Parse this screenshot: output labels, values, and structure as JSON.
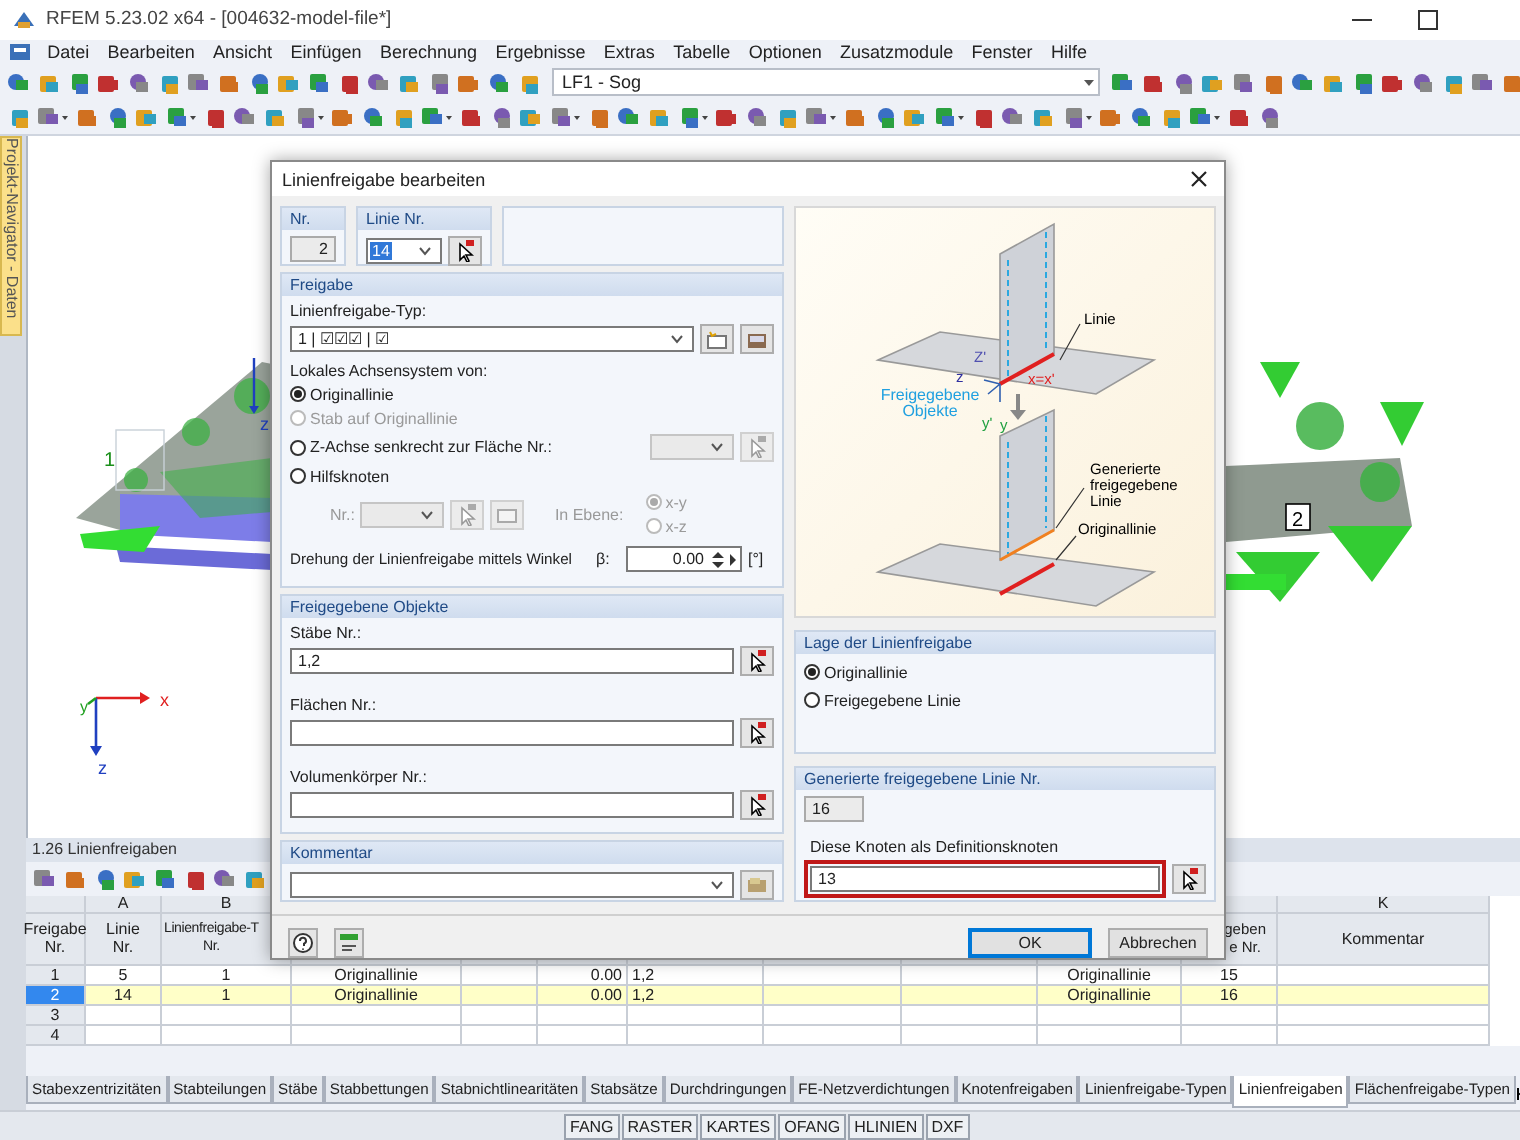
{
  "window": {
    "title": "RFEM 5.23.02 x64 - [004632-model-file*]"
  },
  "menu": [
    "Datei",
    "Bearbeiten",
    "Ansicht",
    "Einfügen",
    "Berechnung",
    "Ergebnisse",
    "Extras",
    "Tabelle",
    "Optionen",
    "Zusatzmodule",
    "Fenster",
    "Hilfe"
  ],
  "toolbar": {
    "load_case": "LF1 - Sog"
  },
  "navigator_tab": "Projekt-Navigator - Daten",
  "view": {
    "labels": [
      {
        "text": "1",
        "color": "#1a8f1a"
      },
      {
        "text": "2",
        "color": "#000000"
      },
      {
        "text": "z",
        "color": "#2040c0"
      },
      {
        "text": "x",
        "color": "#e02020"
      },
      {
        "text": "y",
        "color": "#20a020"
      },
      {
        "text": "z",
        "color": "#2040c0"
      }
    ]
  },
  "table": {
    "title": "1.26 Linienfreigaben",
    "row_header": "Freigabe\nNr.",
    "columns": [
      {
        "letter": "A",
        "header": "Linie\nNr."
      },
      {
        "letter": "B",
        "header": "Linienfreigabe-T\nNr."
      },
      null,
      null,
      null,
      null,
      null,
      null,
      null,
      {
        "header": "geben\ne Nr."
      },
      {
        "letter": "K",
        "header": "Kommentar"
      }
    ],
    "rows": [
      {
        "number": "1",
        "selected": false,
        "cells": [
          "5",
          "1",
          "Originallinie",
          null,
          "0.00",
          "1,2",
          null,
          null,
          "Originallinie",
          "15",
          null
        ]
      },
      {
        "number": "2",
        "selected": true,
        "cells": [
          "14",
          "1",
          "Originallinie",
          null,
          "0.00",
          "1,2",
          null,
          null,
          "Originallinie",
          "16",
          null
        ]
      },
      {
        "number": "3",
        "selected": false,
        "cells": [
          null,
          null,
          null,
          null,
          null,
          null,
          null,
          null,
          null,
          null,
          null
        ]
      },
      {
        "number": "4",
        "selected": false,
        "cells": [
          null,
          null,
          null,
          null,
          null,
          null,
          null,
          null,
          null,
          null,
          null
        ]
      }
    ]
  },
  "sheet_tabs": [
    {
      "label": "Stabexzentrizitäten",
      "selected": false
    },
    {
      "label": "Stabteilungen",
      "selected": false
    },
    {
      "label": "Stäbe",
      "selected": false
    },
    {
      "label": "Stabbettungen",
      "selected": false
    },
    {
      "label": "Stabnichtlinearitäten",
      "selected": false
    },
    {
      "label": "Stabsätze",
      "selected": false
    },
    {
      "label": "Durchdringungen",
      "selected": false
    },
    {
      "label": "FE-Netzverdichtungen",
      "selected": false
    },
    {
      "label": "Knotenfreigaben",
      "selected": false
    },
    {
      "label": "Linienfreigabe-Typen",
      "selected": false
    },
    {
      "label": "Linienfreigaben",
      "selected": true
    },
    {
      "label": "Flächenfreigabe-Typen",
      "selected": false
    }
  ],
  "status_bar": [
    "FANG",
    "RASTER",
    "KARTES",
    "OFANG",
    "HLINIEN",
    "DXF"
  ],
  "dialog": {
    "title": "Linienfreigabe bearbeiten",
    "nr": {
      "label": "Nr.",
      "value": "2"
    },
    "line": {
      "label": "Linie Nr.",
      "value": "14"
    },
    "release": {
      "heading": "Freigabe",
      "type_label": "Linienfreigabe-Typ:",
      "type_value": "1 | ☑☑☑ | ☑",
      "axis_label": "Lokales Achsensystem von:",
      "axis_options": [
        {
          "label": "Originallinie",
          "selected": true,
          "disabled": false
        },
        {
          "label": "Stab auf Originallinie",
          "selected": false,
          "disabled": true
        },
        {
          "label": "Z-Achse senkrecht zur Fläche Nr.:",
          "selected": false,
          "disabled": false
        },
        {
          "label": "Hilfsknoten",
          "selected": false,
          "disabled": false
        }
      ],
      "node_label": "Nr.:",
      "plane_label": "In Ebene:",
      "plane_options": [
        {
          "label": "x-y",
          "selected": true,
          "disabled": true
        },
        {
          "label": "x-z",
          "selected": false,
          "disabled": true
        }
      ],
      "rotation_label": "Drehung der Linienfreigabe mittels Winkel",
      "beta_label": "β:",
      "beta_value": "0.00",
      "unit": "[°]"
    },
    "objects": {
      "heading": "Freigegebene Objekte",
      "fields": [
        {
          "label": "Stäbe Nr.:",
          "value": "1,2"
        },
        {
          "label": "Flächen Nr.:"
        },
        {
          "label": "Volumenkörper Nr.:"
        }
      ]
    },
    "comment": {
      "heading": "Kommentar"
    },
    "figure": {
      "labels": [
        {
          "text": "Linie",
          "color": "#000000"
        },
        {
          "text": "x=x'",
          "color": "#e02020"
        },
        {
          "text": "Z'",
          "color": "#5050b0"
        },
        {
          "text": "z",
          "color": "#3030a0"
        },
        {
          "text": "y'",
          "color": "#20a040"
        },
        {
          "text": "y",
          "color": "#20a040"
        },
        {
          "text": "Freigegebene Objekte",
          "color": "#20a0e0"
        },
        {
          "text": "Generierte freigegebene Linie",
          "color": "#000000"
        },
        {
          "text": "Originallinie",
          "color": "#000000"
        }
      ]
    },
    "position": {
      "heading": "Lage der Linienfreigabe",
      "options": [
        {
          "label": "Originallinie",
          "selected": true
        },
        {
          "label": "Freigegebene Linie",
          "selected": false
        }
      ]
    },
    "generated": {
      "heading": "Generierte freigegebene Linie Nr.",
      "number": "16",
      "nodes_label": "Diese Knoten als Definitionsknoten",
      "nodes_value": "13",
      "highlighted": true
    },
    "buttons": [
      {
        "label": "OK",
        "default": true
      },
      {
        "label": "Abbrechen",
        "default": false
      }
    ]
  }
}
